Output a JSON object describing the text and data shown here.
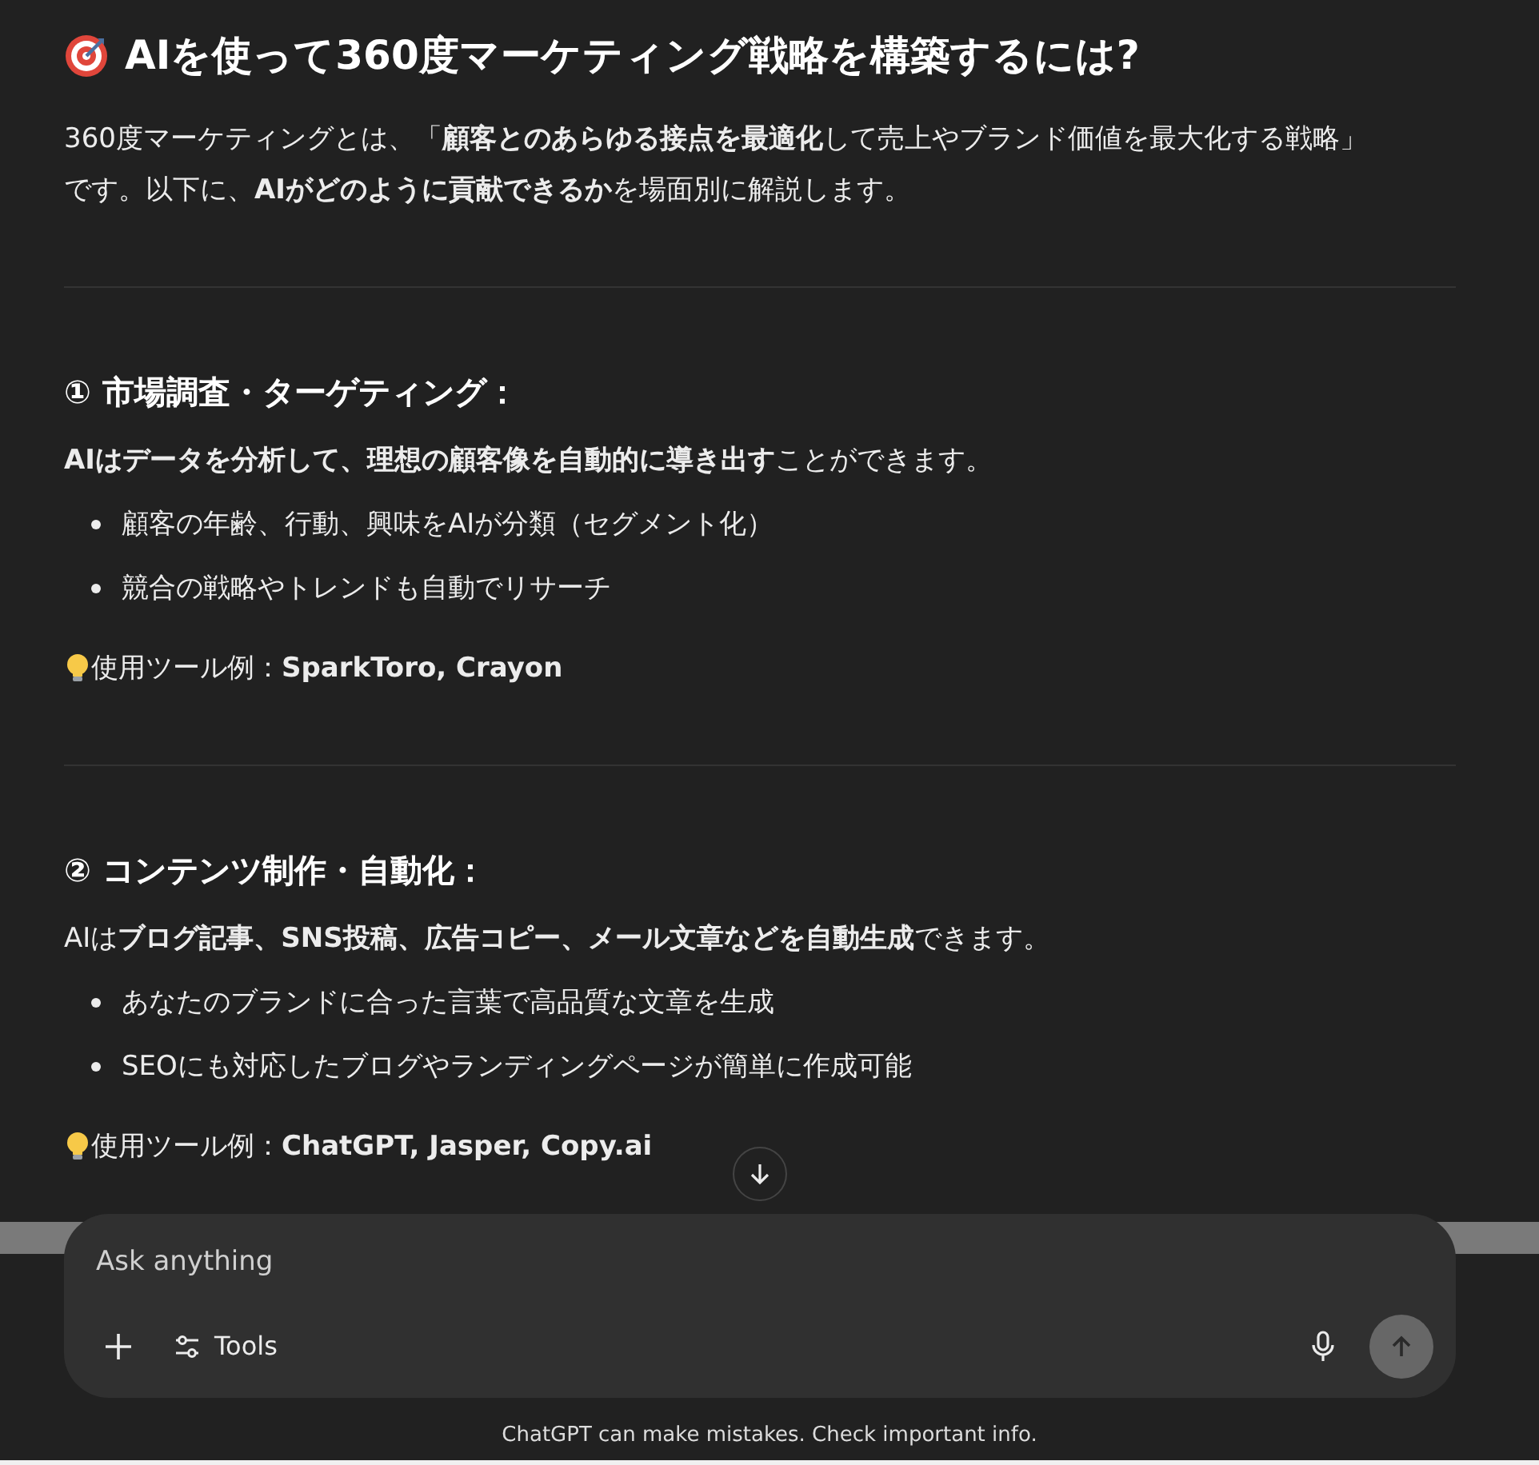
{
  "title": "AIを使って360度マーケティング戦略を構築するには?",
  "intro": "360度マーケティングとは、「**顧客とのあらゆる接点を最適化**して売上やブランド価値を最大化する戦略」です。以下に、**AIがどのように貢献できるか**を場面別に解説します。",
  "sections": [
    {
      "heading": "① 市場調査・ターゲティング：",
      "lead": "**AIはデータを分析して、理想の顧客像を自動的に導き出す**ことができます。",
      "bullets": [
        "顧客の年齢、行動、興味をAIが分類（セグメント化）",
        "競合の戦略やトレンドも自動でリサーチ"
      ],
      "tools": "使用ツール例：**SparkToro, Crayon**"
    },
    {
      "heading": "② コンテンツ制作・自動化：",
      "lead": "AIは**ブログ記事、SNS投稿、広告コピー、メール文章などを自動生成**できます。",
      "bullets": [
        "あなたのブランドに合った言葉で高品質な文章を生成",
        "SEOにも対応したブログやランディングページが簡単に作成可能"
      ],
      "tools": "使用ツール例：**ChatGPT, Jasper, Copy.ai**"
    }
  ],
  "composer": {
    "placeholder": "Ask anything",
    "tools_label": "Tools"
  },
  "disclaimer": "ChatGPT can make mistakes. Check important info."
}
